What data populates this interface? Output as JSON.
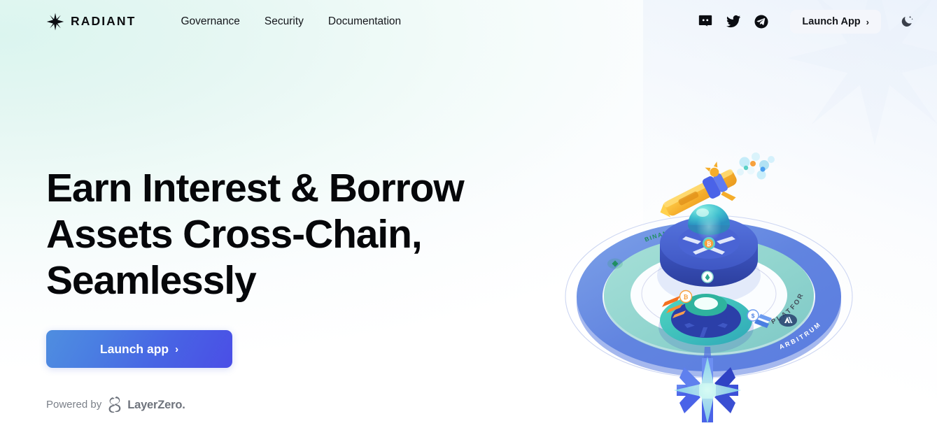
{
  "brand": {
    "name": "RADIANT",
    "logo_icon": "eight-point-star-icon"
  },
  "nav": {
    "items": [
      {
        "label": "Governance"
      },
      {
        "label": "Security"
      },
      {
        "label": "Documentation"
      }
    ]
  },
  "socials": [
    {
      "name": "discord",
      "icon": "discord-icon"
    },
    {
      "name": "twitter",
      "icon": "twitter-icon"
    },
    {
      "name": "telegram",
      "icon": "telegram-icon"
    }
  ],
  "header": {
    "launch_app_label": "Launch App",
    "launch_app_chevron": "›",
    "theme_toggle_icon": "moon-icon"
  },
  "hero": {
    "title": "Earn Interest & Borrow\nAssets Cross-Chain,\nSeamlessly",
    "cta_label": "Launch app",
    "cta_chevron": "›",
    "powered_by_label": "Powered by",
    "powered_by_brand": "LayerZero.",
    "powered_by_icon": "layerzero-icon"
  },
  "illustration": {
    "name": "cross-chain-lending-3d-illustration",
    "outer_ring_label": "ARBITRUM",
    "inner_ring_label": "PLATFORM FEES",
    "chain_label": "BINANCE SMART CHAIN",
    "bottom_star_icon": "radiant-star-3d-icon",
    "arbitrum_badge_icon": "arbitrum-logo-icon",
    "bsc_badge_icon": "binance-logo-icon"
  },
  "colors": {
    "accent_blue": "#4a5fe4",
    "cta_gradient_start": "#4f8ee0",
    "cta_gradient_end": "#4a4ee6",
    "outer_ring": "#6a90e4",
    "inner_ring": "#93d9d2",
    "text_primary": "#06070a",
    "text_muted": "#7b8089",
    "bg_tint": "#dbf5ef"
  }
}
